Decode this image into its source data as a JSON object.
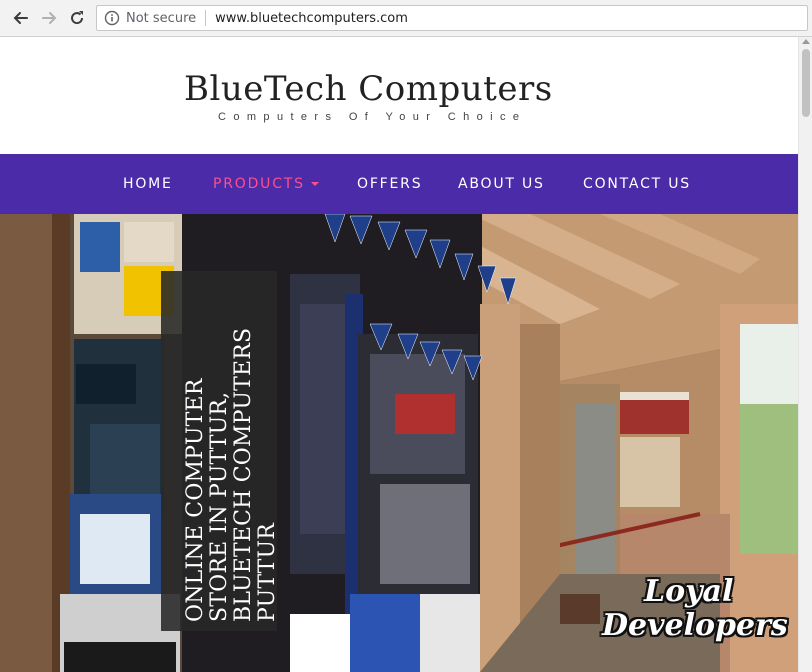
{
  "browser": {
    "security_label": "Not secure",
    "url": "www.bluetechcomputers.com",
    "icons": [
      "back-arrow-icon",
      "forward-arrow-icon",
      "reload-icon",
      "info-icon"
    ]
  },
  "site": {
    "title": "BlueTech Computers",
    "tagline": "Computers Of Your Choice"
  },
  "menu": {
    "items": [
      {
        "label": "HOME"
      },
      {
        "label": "PRODUCTS"
      },
      {
        "label": "OFFERS"
      },
      {
        "label": "ABOUT US"
      },
      {
        "label": "CONTACT US"
      }
    ],
    "active": "PRODUCTS",
    "colors": {
      "background": "#4b2ba8",
      "text": "#ffffff",
      "active": "#ff4f8a"
    }
  },
  "hero": {
    "heading": "ONLINE COMPUTER STORE IN PUTTUR, BLUETECH COMPUTERS PUTTUR",
    "watermark": {
      "line1": "Loyal",
      "line2": "Developers"
    }
  }
}
